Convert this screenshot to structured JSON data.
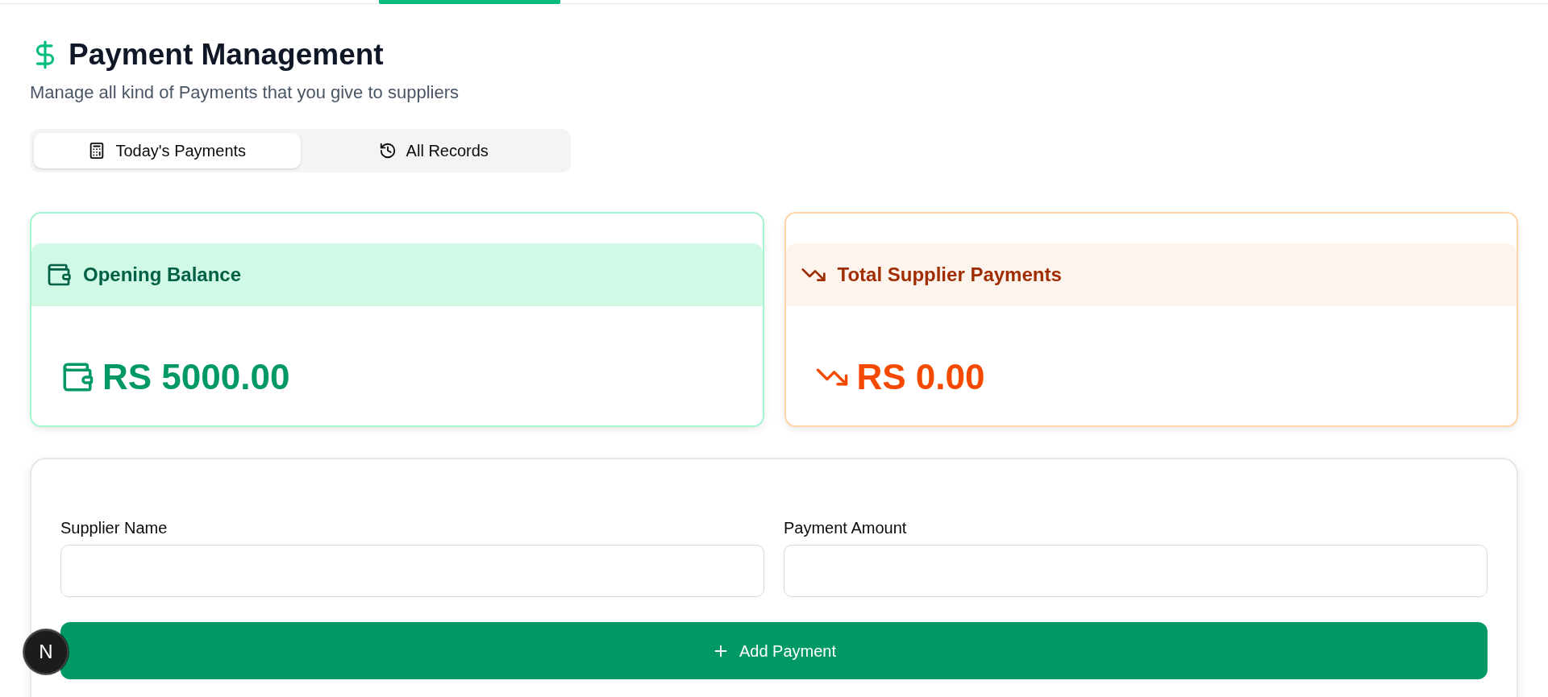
{
  "page": {
    "title": "Payment Management",
    "subtitle": "Manage all kind of Payments that you give to suppliers"
  },
  "tabs": [
    {
      "label": "Today's Payments",
      "selected": true
    },
    {
      "label": "All Records",
      "selected": false
    }
  ],
  "summary_cards": [
    {
      "kind": "balance",
      "title": "Opening Balance",
      "value": "RS 5000.00"
    },
    {
      "kind": "payments",
      "title": "Total Supplier Payments",
      "value": "RS 0.00"
    }
  ],
  "form": {
    "fields": [
      {
        "label": "Supplier Name"
      },
      {
        "label": "Payment Amount"
      }
    ],
    "submit_button": {
      "label": "Add Payment"
    }
  },
  "dev_badge": {
    "label": "N"
  }
}
